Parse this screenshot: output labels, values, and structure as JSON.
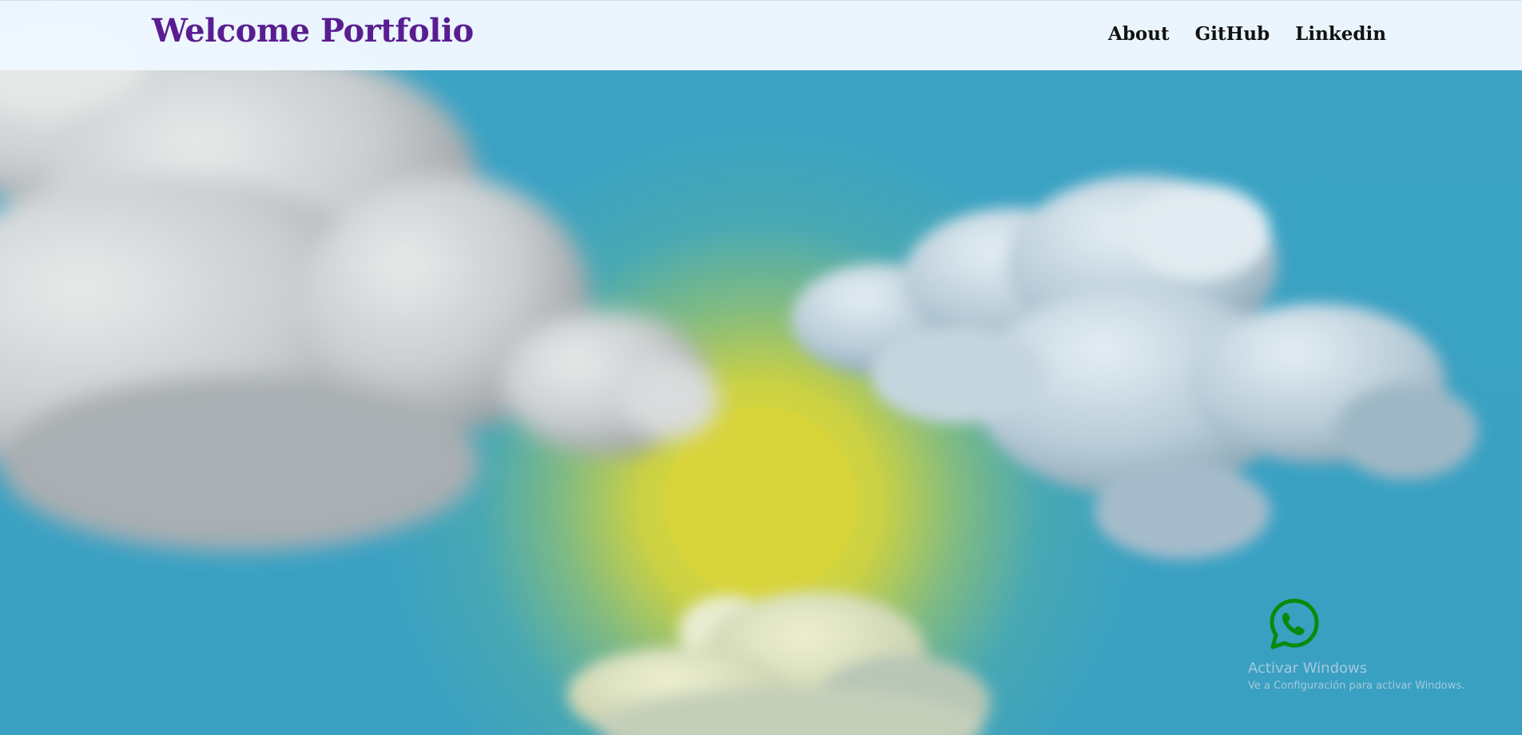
{
  "header": {
    "brand": "Welcome Portfolio",
    "nav": [
      {
        "label": "About"
      },
      {
        "label": "GitHub"
      },
      {
        "label": "Linkedin"
      }
    ]
  },
  "floating": {
    "whatsapp_icon": "whatsapp-icon"
  },
  "watermark": {
    "title": "Activar Windows",
    "subtitle": "Ve a Configuración para activar Windows."
  },
  "colors": {
    "brand": "#5a1d91",
    "sky": "#3aa2c3",
    "sun": "#d7d43a",
    "whatsapp": "#0a8a0a",
    "header_bg": "#f0f8ff"
  }
}
